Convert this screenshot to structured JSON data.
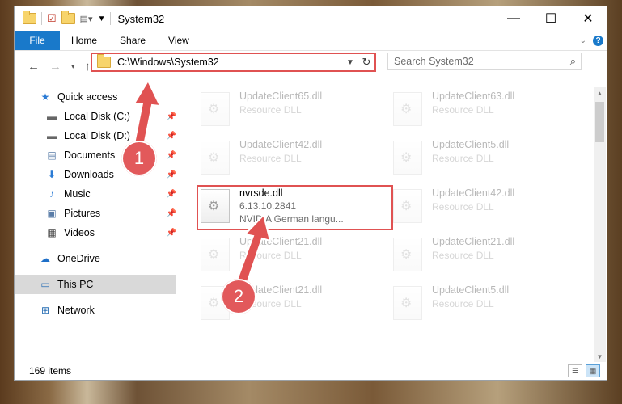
{
  "window": {
    "title": "System32",
    "controls": {
      "minimize": "—",
      "maximize": "☐",
      "close": "✕"
    }
  },
  "ribbon": {
    "tabs": [
      "File",
      "Home",
      "Share",
      "View"
    ]
  },
  "nav": {
    "address": "C:\\Windows\\System32",
    "search_placeholder": "Search System32"
  },
  "sidebar": {
    "items": [
      {
        "label": "Quick access",
        "icon": "star-icon"
      },
      {
        "label": "Local Disk (C:)",
        "icon": "drive-icon"
      },
      {
        "label": "Local Disk (D:)",
        "icon": "drive-icon"
      },
      {
        "label": "Documents",
        "icon": "documents-icon"
      },
      {
        "label": "Downloads",
        "icon": "download-icon"
      },
      {
        "label": "Music",
        "icon": "music-icon"
      },
      {
        "label": "Pictures",
        "icon": "pictures-icon"
      },
      {
        "label": "Videos",
        "icon": "videos-icon"
      },
      {
        "label": "OneDrive",
        "icon": "cloud-icon"
      },
      {
        "label": "This PC",
        "icon": "computer-icon"
      },
      {
        "label": "Network",
        "icon": "network-icon"
      }
    ]
  },
  "files": [
    {
      "name": "UpdateClient65.dll",
      "type": "Resource DLL"
    },
    {
      "name": "UpdateClient63.dll",
      "type": "Resource DLL"
    },
    {
      "name": "UpdateClient42.dll",
      "type": "Resource DLL"
    },
    {
      "name": "UpdateClient5.dll",
      "type": "Resource DLL"
    },
    {
      "name": "nvrsde.dll",
      "version": "6.13.10.2841",
      "description": "NVIDIA German langu..."
    },
    {
      "name": "UpdateClient42.dll",
      "type": "Resource DLL"
    },
    {
      "name": "UpdateClient21.dll",
      "type": "Resource DLL"
    },
    {
      "name": "UpdateClient21.dll",
      "type": "Resource DLL"
    },
    {
      "name": "UpdateClient21.dll",
      "type": "Resource DLL"
    },
    {
      "name": "UpdateClient5.dll",
      "type": "Resource DLL"
    }
  ],
  "status": {
    "item_count": "169 items"
  },
  "annotations": {
    "step1": "1",
    "step2": "2",
    "color": "#e05252"
  }
}
